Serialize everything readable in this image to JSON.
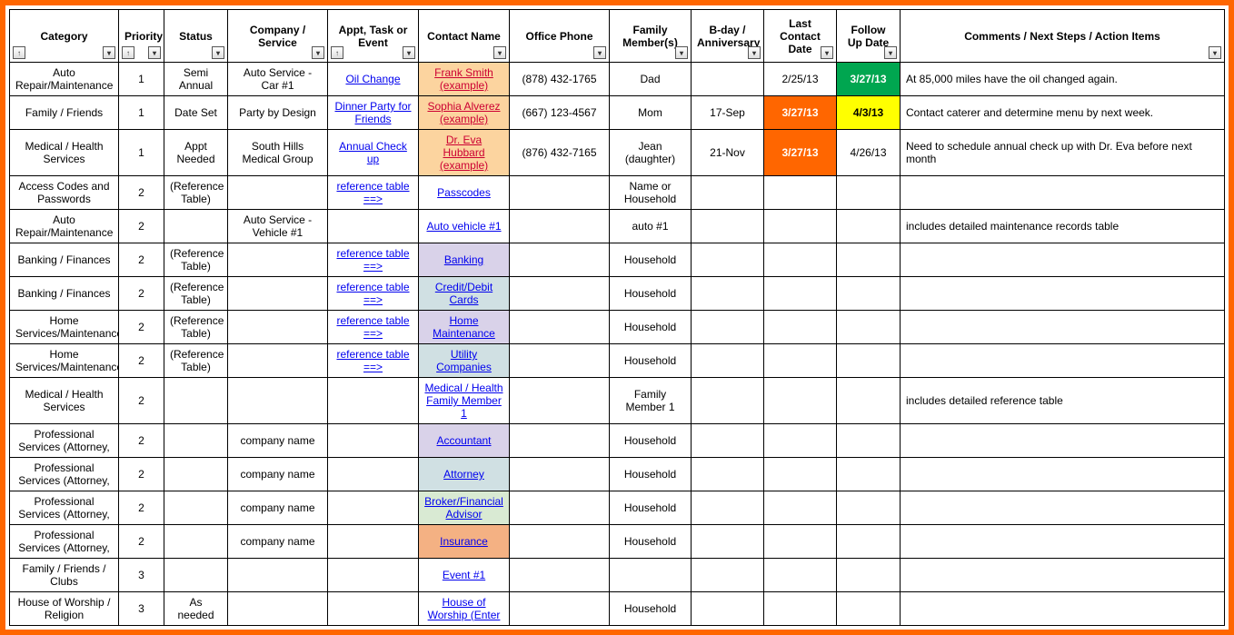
{
  "headers": [
    {
      "label": "Category",
      "sort": true,
      "filter": true
    },
    {
      "label": "Priority",
      "sort": true,
      "filter": true
    },
    {
      "label": "Status",
      "sort": false,
      "filter": true
    },
    {
      "label": "Company / Service",
      "sort": false,
      "filter": true
    },
    {
      "label": "Appt, Task or Event",
      "sort": true,
      "filter": true
    },
    {
      "label": "Contact Name",
      "sort": false,
      "filter": true
    },
    {
      "label": "Office Phone",
      "sort": false,
      "filter": true
    },
    {
      "label": "Family Member(s)",
      "sort": false,
      "filter": true
    },
    {
      "label": "B-day / Anniversary",
      "sort": false,
      "filter": true
    },
    {
      "label": "Last Contact Date",
      "sort": false,
      "filter": true
    },
    {
      "label": "Follow Up Date",
      "sort": false,
      "filter": true
    },
    {
      "label": "Comments / Next Steps / Action Items",
      "sort": false,
      "filter": true
    }
  ],
  "rows": [
    {
      "category": "Auto Repair/Maintenance",
      "priority": "1",
      "status": "Semi Annual",
      "company": "Auto Service - Car #1",
      "task": {
        "text": "Oil Change",
        "cls": "link"
      },
      "contact": {
        "text": "Frank Smith (example)",
        "cls": "linkred",
        "bg": "bg-peach"
      },
      "phone": "(878) 432-1765",
      "family": "Dad",
      "bday": "",
      "last": {
        "text": "2/25/13"
      },
      "follow": {
        "text": "3/27/13",
        "bg": "bg-green"
      },
      "comments": "At 85,000 miles have the oil changed again."
    },
    {
      "category": "Family / Friends",
      "priority": "1",
      "status": "Date Set",
      "company": "Party by Design",
      "task": {
        "text": "Dinner Party for Friends",
        "cls": "link"
      },
      "contact": {
        "text": "Sophia Alverez (example)",
        "cls": "linkred",
        "bg": "bg-peach"
      },
      "phone": "(667) 123-4567",
      "family": "Mom",
      "bday": "17-Sep",
      "last": {
        "text": "3/27/13",
        "bg": "bg-orange"
      },
      "follow": {
        "text": "4/3/13",
        "bg": "bg-yellow"
      },
      "comments": "Contact caterer and determine menu by next week."
    },
    {
      "category": "Medical / Health Services",
      "priority": "1",
      "status": "Appt Needed",
      "company": "South Hills Medical Group",
      "task": {
        "text": "Annual Check up",
        "cls": "link"
      },
      "contact": {
        "text": "Dr. Eva Hubbard (example)",
        "cls": "linkred",
        "bg": "bg-peach"
      },
      "phone": "(876) 432-7165",
      "family": "Jean (daughter)",
      "bday": "21-Nov",
      "last": {
        "text": "3/27/13",
        "bg": "bg-orange"
      },
      "follow": {
        "text": "4/26/13"
      },
      "comments": "Need to schedule annual check up with Dr. Eva before next month"
    },
    {
      "category": "Access Codes and Passwords",
      "priority": "2",
      "status": "(Reference Table)",
      "company": "",
      "task": {
        "text": "reference table ==>",
        "cls": "link"
      },
      "contact": {
        "text": "Passcodes ",
        "cls": "link",
        "bg": ""
      },
      "phone": "",
      "family": "Name or Household",
      "bday": "",
      "last": {
        "text": ""
      },
      "follow": {
        "text": ""
      },
      "comments": ""
    },
    {
      "category": "Auto Repair/Maintenance",
      "priority": "2",
      "status": "",
      "company": "Auto Service - Vehicle #1",
      "task": {
        "text": ""
      },
      "contact": {
        "text": "Auto vehicle #1",
        "cls": "link",
        "bg": ""
      },
      "phone": "",
      "family": "auto #1",
      "bday": "",
      "last": {
        "text": ""
      },
      "follow": {
        "text": ""
      },
      "comments": "includes detailed maintenance records table"
    },
    {
      "category": "Banking / Finances",
      "priority": "2",
      "status": "(Reference Table)",
      "company": "",
      "task": {
        "text": "reference table ==>",
        "cls": "link"
      },
      "contact": {
        "text": "Banking ",
        "cls": "link",
        "bg": "bg-lav"
      },
      "phone": "",
      "family": "Household",
      "bday": "",
      "last": {
        "text": ""
      },
      "follow": {
        "text": ""
      },
      "comments": ""
    },
    {
      "category": "Banking / Finances",
      "priority": "2",
      "status": "(Reference Table)",
      "company": "",
      "task": {
        "text": "reference table ==>",
        "cls": "link"
      },
      "contact": {
        "text": "Credit/Debit Cards ",
        "cls": "link",
        "bg": "bg-lblue"
      },
      "phone": "",
      "family": "Household",
      "bday": "",
      "last": {
        "text": ""
      },
      "follow": {
        "text": ""
      },
      "comments": ""
    },
    {
      "category": "Home Services/Maintenance",
      "priority": "2",
      "status": "(Reference Table)",
      "company": "",
      "task": {
        "text": "reference table ==>",
        "cls": "link"
      },
      "contact": {
        "text": "Home Maintenance ",
        "cls": "link",
        "bg": "bg-lav"
      },
      "phone": "",
      "family": "Household",
      "bday": "",
      "last": {
        "text": ""
      },
      "follow": {
        "text": ""
      },
      "comments": ""
    },
    {
      "category": "Home Services/Maintenance",
      "priority": "2",
      "status": "(Reference Table)",
      "company": "",
      "task": {
        "text": "reference table ==>",
        "cls": "link"
      },
      "contact": {
        "text": "Utility Companies",
        "cls": "link",
        "bg": "bg-lblue"
      },
      "phone": "",
      "family": "Household",
      "bday": "",
      "last": {
        "text": ""
      },
      "follow": {
        "text": ""
      },
      "comments": ""
    },
    {
      "category": "Medical / Health Services",
      "priority": "2",
      "status": "",
      "company": "",
      "task": {
        "text": ""
      },
      "contact": {
        "text": "Medical / Health Family Member 1",
        "cls": "link",
        "bg": ""
      },
      "phone": "",
      "family": "Family Member 1",
      "bday": "",
      "last": {
        "text": ""
      },
      "follow": {
        "text": ""
      },
      "comments": "includes detailed reference table"
    },
    {
      "category": "Professional Services (Attorney,",
      "priority": "2",
      "status": "",
      "company": "company name",
      "task": {
        "text": ""
      },
      "contact": {
        "text": "Accountant ",
        "cls": "link",
        "bg": "bg-lav"
      },
      "phone": "",
      "family": "Household",
      "bday": "",
      "last": {
        "text": ""
      },
      "follow": {
        "text": ""
      },
      "comments": ""
    },
    {
      "category": "Professional Services (Attorney,",
      "priority": "2",
      "status": "",
      "company": "company name",
      "task": {
        "text": ""
      },
      "contact": {
        "text": "Attorney ",
        "cls": "link",
        "bg": "bg-lblue"
      },
      "phone": "",
      "family": "Household",
      "bday": "",
      "last": {
        "text": ""
      },
      "follow": {
        "text": ""
      },
      "comments": ""
    },
    {
      "category": "Professional Services (Attorney,",
      "priority": "2",
      "status": "",
      "company": "company name",
      "task": {
        "text": ""
      },
      "contact": {
        "text": "Broker/Financial Advisor ",
        "cls": "link",
        "bg": "bg-lgreen"
      },
      "phone": "",
      "family": "Household",
      "bday": "",
      "last": {
        "text": ""
      },
      "follow": {
        "text": ""
      },
      "comments": ""
    },
    {
      "category": "Professional Services (Attorney,",
      "priority": "2",
      "status": "",
      "company": "company name",
      "task": {
        "text": ""
      },
      "contact": {
        "text": "Insurance ",
        "cls": "link",
        "bg": "bg-salmon"
      },
      "phone": "",
      "family": "Household",
      "bday": "",
      "last": {
        "text": ""
      },
      "follow": {
        "text": ""
      },
      "comments": ""
    },
    {
      "category": "Family / Friends / Clubs",
      "priority": "3",
      "status": "",
      "company": "",
      "task": {
        "text": ""
      },
      "contact": {
        "text": "Event #1",
        "cls": "link",
        "bg": ""
      },
      "phone": "",
      "family": "",
      "bday": "",
      "last": {
        "text": ""
      },
      "follow": {
        "text": ""
      },
      "comments": ""
    },
    {
      "category": "House of Worship / Religion",
      "priority": "3",
      "status": "As needed",
      "company": "",
      "task": {
        "text": ""
      },
      "contact": {
        "text": "House of Worship (Enter",
        "cls": "link",
        "bg": ""
      },
      "phone": "",
      "family": "Household",
      "bday": "",
      "last": {
        "text": ""
      },
      "follow": {
        "text": ""
      },
      "comments": ""
    }
  ]
}
